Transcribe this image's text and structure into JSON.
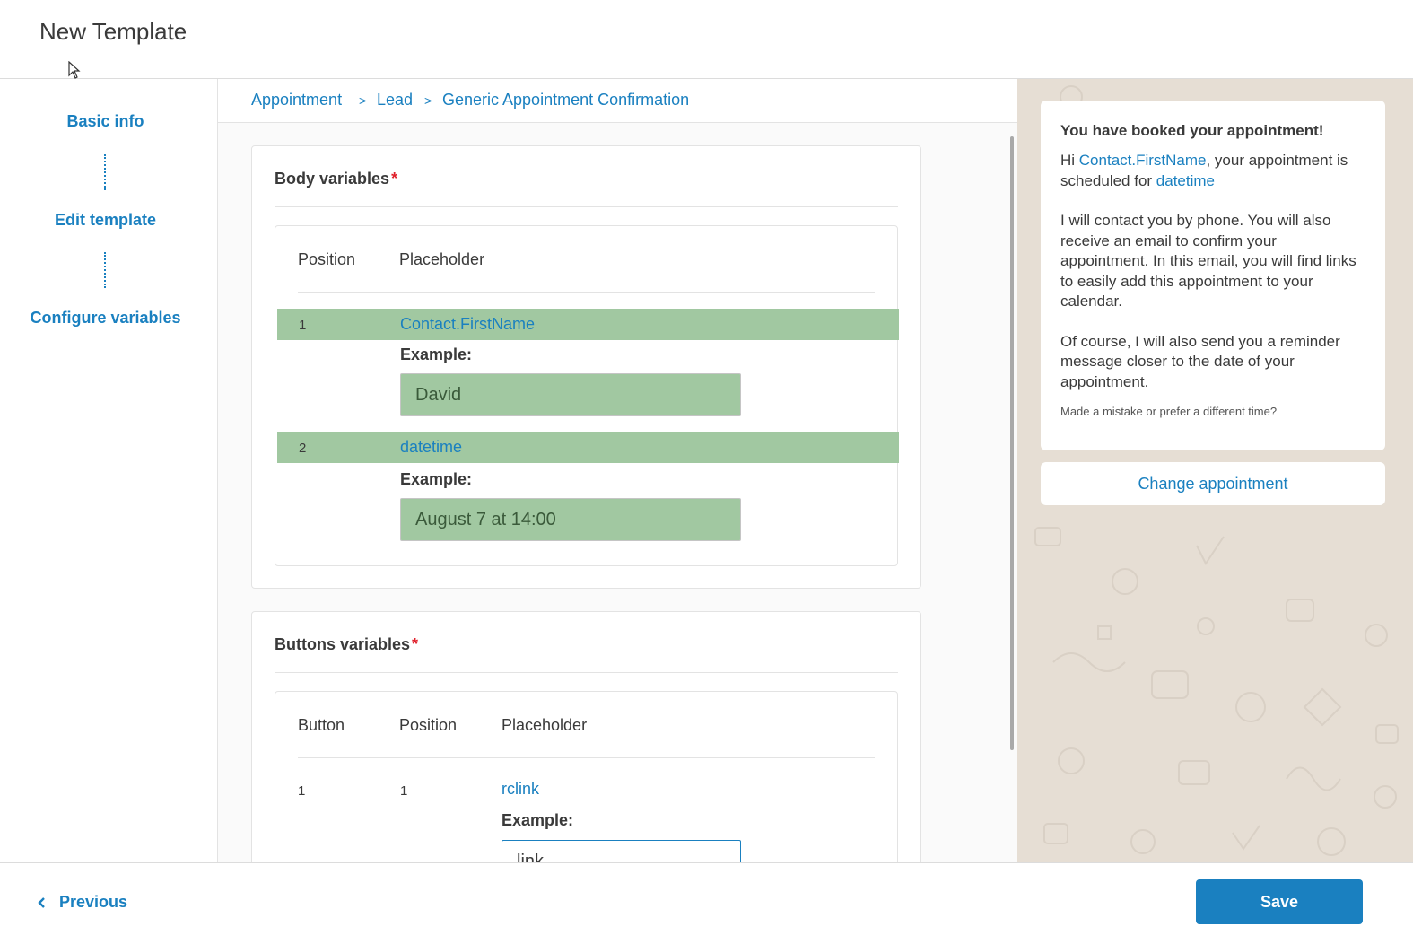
{
  "header": {
    "title": "New Template"
  },
  "sidebar": {
    "steps": [
      {
        "label": "Basic info"
      },
      {
        "label": "Edit template"
      },
      {
        "label": "Configure variables"
      }
    ]
  },
  "breadcrumb": {
    "items": [
      "Appointment",
      "Lead",
      "Generic Appointment Confirmation"
    ],
    "separator": ">"
  },
  "body_variables": {
    "title": "Body variables",
    "required_mark": "*",
    "columns": [
      "Position",
      "Placeholder"
    ],
    "rows": [
      {
        "position": "1",
        "placeholder": "Contact.FirstName",
        "example_label": "Example:",
        "example_value": "David"
      },
      {
        "position": "2",
        "placeholder": "datetime",
        "example_label": "Example:",
        "example_value": "August 7 at 14:00"
      }
    ]
  },
  "buttons_variables": {
    "title": "Buttons variables",
    "required_mark": "*",
    "columns": [
      "Button",
      "Position",
      "Placeholder"
    ],
    "rows": [
      {
        "button": "1",
        "position": "1",
        "placeholder": "rclink",
        "example_label": "Example:",
        "example_value": "link"
      }
    ]
  },
  "preview": {
    "title": "You have booked your appointment!",
    "para1_prefix": "Hi ",
    "para1_var1": "Contact.FirstName",
    "para1_mid": ", your appointment is scheduled for ",
    "para1_var2": "datetime",
    "para2": "I will contact you by phone. You will also receive an email to confirm your appointment. In this email, you will find links to easily add this appointment to your calendar.",
    "para3": "Of course, I will also send you a reminder message closer to the date of your appointment.",
    "footer": "Made a mistake or prefer a different time?",
    "button": "Change appointment"
  },
  "footer": {
    "previous_label": "Previous",
    "save_label": "Save"
  },
  "colors": {
    "accent": "#1a80c0",
    "highlight": "#a1c8a1",
    "required": "#e0212c",
    "preview_bg": "#e6ded4"
  }
}
